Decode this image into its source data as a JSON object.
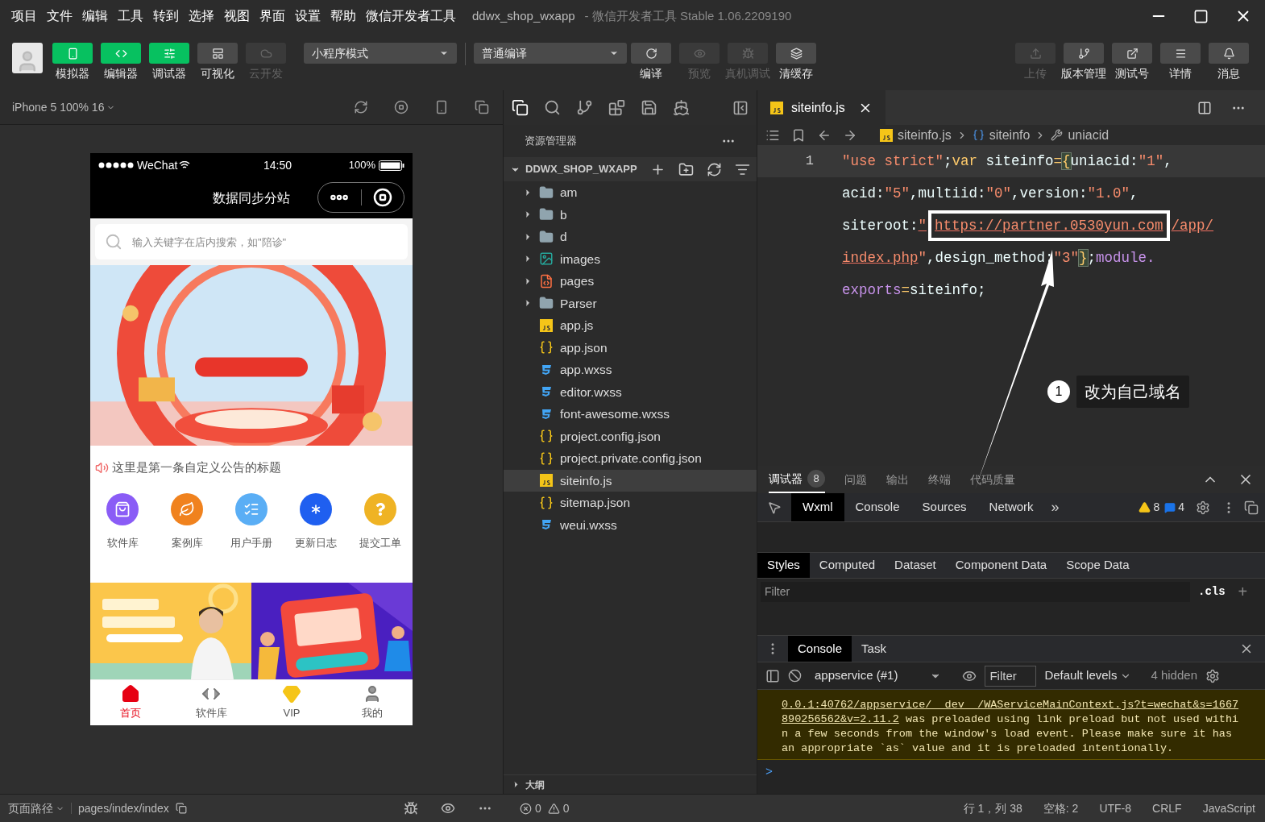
{
  "menu": [
    "项目",
    "文件",
    "编辑",
    "工具",
    "转到",
    "选择",
    "视图",
    "界面",
    "设置",
    "帮助",
    "微信开发者工具"
  ],
  "window": {
    "title": "ddwx_shop_wxapp",
    "subtitle": "- 微信开发者工具 Stable 1.06.2209190"
  },
  "toolbar": {
    "views": [
      {
        "label": "模拟器",
        "on": true,
        "disabled": false
      },
      {
        "label": "编辑器",
        "on": true,
        "disabled": false
      },
      {
        "label": "调试器",
        "on": true,
        "disabled": false
      },
      {
        "label": "可视化",
        "on": false,
        "disabled": false
      },
      {
        "label": "云开发",
        "on": false,
        "disabled": true
      }
    ],
    "mode": "小程序模式",
    "compile": "普通编译",
    "actions": [
      {
        "label": "编译",
        "disabled": false
      },
      {
        "label": "预览",
        "disabled": true
      },
      {
        "label": "真机调试",
        "disabled": true
      },
      {
        "label": "清缓存",
        "disabled": false
      }
    ],
    "right_actions": [
      {
        "label": "上传",
        "disabled": true
      },
      {
        "label": "版本管理",
        "disabled": false
      },
      {
        "label": "测试号",
        "disabled": false
      },
      {
        "label": "详情",
        "disabled": false
      },
      {
        "label": "消息",
        "disabled": false
      }
    ]
  },
  "simulator": {
    "device": "iPhone 5 100% 16",
    "phone": {
      "carrier": "WeChat",
      "time": "14:50",
      "battery": "100%",
      "title": "数据同步分站",
      "search": {
        "placeholder": "输入关键字在店内搜索，如\"陪诊\""
      },
      "notice": "这里是第一条自定义公告的标题",
      "shortcuts": [
        {
          "label": "软件库",
          "color": "#8a5cf6"
        },
        {
          "label": "案例库",
          "color": "#f0821e"
        },
        {
          "label": "用户手册",
          "color": "#5aaef5"
        },
        {
          "label": "更新日志",
          "color": "#1f5ff0"
        },
        {
          "label": "提交工单",
          "color": "#efb324"
        }
      ],
      "tabbar": [
        {
          "label": "首页",
          "selected": true
        },
        {
          "label": "软件库",
          "selected": false
        },
        {
          "label": "VIP",
          "selected": false
        },
        {
          "label": "我的",
          "selected": false
        }
      ]
    }
  },
  "explorer": {
    "title": "资源管理器",
    "project": "DDWX_SHOP_WXAPP",
    "items": [
      {
        "name": "am",
        "kind": "folder",
        "expanded": false,
        "selected": false
      },
      {
        "name": "b",
        "kind": "folder",
        "expanded": false,
        "selected": false
      },
      {
        "name": "d",
        "kind": "folder",
        "expanded": false,
        "selected": false
      },
      {
        "name": "images",
        "kind": "imgfolder",
        "expanded": false,
        "selected": false
      },
      {
        "name": "pages",
        "kind": "pagefolder",
        "expanded": false,
        "selected": false
      },
      {
        "name": "Parser",
        "kind": "folder",
        "expanded": false,
        "selected": false
      },
      {
        "name": "app.js",
        "kind": "js",
        "selected": false
      },
      {
        "name": "app.json",
        "kind": "json",
        "selected": false
      },
      {
        "name": "app.wxss",
        "kind": "css",
        "selected": false
      },
      {
        "name": "editor.wxss",
        "kind": "css",
        "selected": false
      },
      {
        "name": "font-awesome.wxss",
        "kind": "css",
        "selected": false
      },
      {
        "name": "project.config.json",
        "kind": "json",
        "selected": false
      },
      {
        "name": "project.private.config.json",
        "kind": "json",
        "selected": false
      },
      {
        "name": "siteinfo.js",
        "kind": "js",
        "selected": true
      },
      {
        "name": "sitemap.json",
        "kind": "json",
        "selected": false
      },
      {
        "name": "weui.wxss",
        "kind": "css",
        "selected": false
      }
    ],
    "outline": "大纲"
  },
  "editor": {
    "tab": "siteinfo.js",
    "breadcrumb": [
      {
        "text": "siteinfo.js",
        "kind": "file"
      },
      {
        "text": "siteinfo",
        "kind": "object"
      },
      {
        "text": "uniacid",
        "kind": "property"
      }
    ],
    "lines": [
      {
        "number": "1",
        "current": true,
        "tokens": [
          {
            "kind": "str",
            "text": "\"use strict\""
          },
          {
            "kind": "id",
            "text": ";"
          },
          {
            "kind": "kw",
            "text": "var"
          },
          {
            "kind": "id",
            "text": " siteinfo"
          },
          {
            "kind": "kw",
            "text": "="
          },
          {
            "kind": "brace",
            "text": "{"
          },
          {
            "kind": "id",
            "text": "uniacid:"
          },
          {
            "kind": "str",
            "text": "\"1\""
          },
          {
            "kind": "id",
            "text": ","
          }
        ]
      },
      {
        "current": false,
        "tokens": [
          {
            "kind": "id",
            "text": "acid:"
          },
          {
            "kind": "str",
            "text": "\"5\""
          },
          {
            "kind": "id",
            "text": ",multiid:"
          },
          {
            "kind": "str",
            "text": "\"0\""
          },
          {
            "kind": "id",
            "text": ",version:"
          },
          {
            "kind": "str",
            "text": "\"1.0\""
          },
          {
            "kind": "id",
            "text": ","
          }
        ]
      },
      {
        "current": false,
        "tokens": [
          {
            "kind": "id",
            "text": "siteroot:"
          },
          {
            "kind": "link",
            "text": "\""
          },
          {
            "kind": "boxed",
            "text": "https://partner.0530yun.com"
          },
          {
            "kind": "link",
            "text": "/app/"
          }
        ]
      },
      {
        "current": false,
        "tokens": [
          {
            "kind": "link",
            "text": "index.php"
          },
          {
            "kind": "str",
            "text": "\""
          },
          {
            "kind": "id",
            "text": ",design_method:"
          },
          {
            "kind": "str",
            "text": "\"3\""
          },
          {
            "kind": "brace",
            "text": "}"
          },
          {
            "kind": "id",
            "text": ";"
          },
          {
            "kind": "obj",
            "text": "module."
          }
        ]
      },
      {
        "current": false,
        "tokens": [
          {
            "kind": "obj",
            "text": "exports"
          },
          {
            "kind": "kw",
            "text": "="
          },
          {
            "kind": "id",
            "text": "siteinfo;"
          }
        ]
      }
    ],
    "annotation": {
      "number": "1",
      "text": "改为自己域名"
    }
  },
  "debugger": {
    "tabs": [
      {
        "label": "调试器",
        "badge": "8",
        "selected": true
      },
      {
        "label": "问题",
        "selected": false
      },
      {
        "label": "输出",
        "selected": false
      },
      {
        "label": "终端",
        "selected": false
      },
      {
        "label": "代码质量",
        "selected": false
      }
    ],
    "devtools_tabs": [
      {
        "label": "Wxml",
        "selected": true
      },
      {
        "label": "Console",
        "selected": false
      },
      {
        "label": "Sources",
        "selected": false
      },
      {
        "label": "Network",
        "selected": false
      }
    ],
    "more": "»",
    "warnings": "8",
    "infos": "4",
    "panel_tabs": [
      {
        "label": "Styles",
        "selected": true
      },
      {
        "label": "Computed",
        "selected": false
      },
      {
        "label": "Dataset",
        "selected": false
      },
      {
        "label": "Component Data",
        "selected": false
      },
      {
        "label": "Scope Data",
        "selected": false
      }
    ],
    "filter": {
      "placeholder": "Filter"
    },
    "cls": ".cls",
    "add": "+",
    "drawer_tabs": [
      {
        "label": "Console",
        "selected": true
      },
      {
        "label": "Task",
        "selected": false
      }
    ],
    "context": "appservice (#1)",
    "console_filter": {
      "placeholder": "Filter"
    },
    "levels": "Default levels",
    "hidden": "4 hidden",
    "message": {
      "url": "0.0.1:40762/appservice/__dev__/WAServiceMainContext.js?t=wechat&s=1667890256562&v=2.11.2",
      "text": " was preloaded using link preload but not used within a few seconds from the window's load event. Please make sure it has an appropriate `as` value and it is preloaded intentionally."
    },
    "prompt": ">"
  },
  "status_bar": {
    "path_label": "页面路径",
    "path": "pages/index/index",
    "errors": "0",
    "warns": "0",
    "position": "行 1，列 38",
    "spaces": "空格: 2",
    "encoding": "UTF-8",
    "eol": "CRLF",
    "language": "JavaScript"
  }
}
